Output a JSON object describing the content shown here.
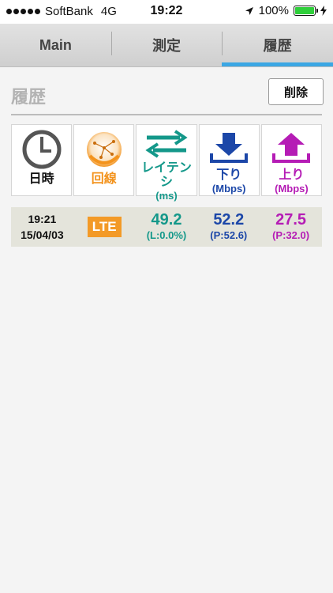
{
  "status_bar": {
    "carrier": "SoftBank",
    "network": "4G",
    "time": "19:22",
    "battery_percent": "100%",
    "battery_level": 1.0
  },
  "tabs": [
    {
      "label": "Main",
      "active": false
    },
    {
      "label": "測定",
      "active": false
    },
    {
      "label": "履歴",
      "active": true
    }
  ],
  "section": {
    "title": "履歴",
    "delete_label": "削除"
  },
  "columns": {
    "datetime": {
      "label": "日時",
      "icon": "clock-icon"
    },
    "line": {
      "label": "回線",
      "icon": "network-orb-icon"
    },
    "latency": {
      "label": "レイテンシ",
      "unit": "(ms)",
      "icon": "latency-arrows-icon"
    },
    "download": {
      "label": "下り",
      "unit": "(Mbps)",
      "icon": "download-icon"
    },
    "upload": {
      "label": "上り",
      "unit": "(Mbps)",
      "icon": "upload-icon"
    }
  },
  "history": [
    {
      "time": "19:21",
      "date": "15/04/03",
      "line_type": "LTE",
      "latency": "49.2",
      "loss": "(L:0.0%)",
      "download": "52.2",
      "download_peak": "(P:52.6)",
      "upload": "27.5",
      "upload_peak": "(P:32.0)"
    }
  ],
  "colors": {
    "accent": "#3ba7e4",
    "orange": "#f3931d",
    "teal": "#14988a",
    "blue": "#1c47a8",
    "magenta": "#b51cb5",
    "row_bg": "#e4e4db"
  }
}
